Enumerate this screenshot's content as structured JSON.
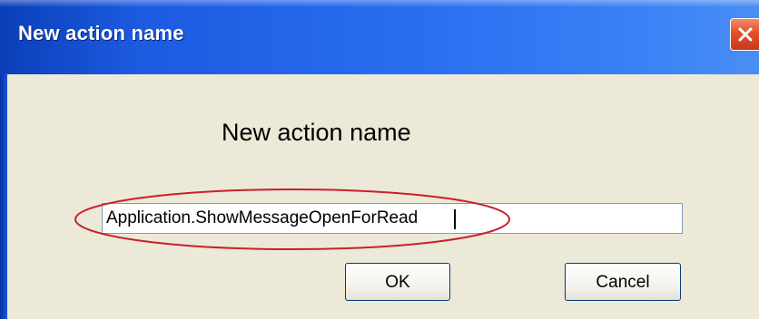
{
  "window": {
    "title": "New action name"
  },
  "dialog": {
    "heading": "New action name",
    "name_field": {
      "value": "Application.ShowMessageOpenForRead"
    },
    "ok_label": "OK",
    "cancel_label": "Cancel"
  },
  "icons": {
    "close": "close-icon"
  },
  "colors": {
    "titlebar": "#2a6ef0",
    "client_background": "#ece9d8",
    "close_button": "#e2512a",
    "annotation_ellipse": "#c8202a"
  }
}
